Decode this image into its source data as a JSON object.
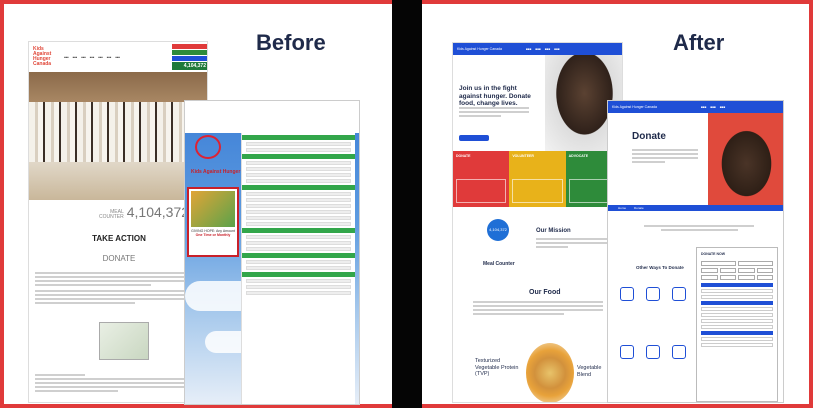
{
  "labels": {
    "before": "Before",
    "after": "After"
  },
  "before_site": {
    "logo": "Kids Against Hunger Canada",
    "meals_counter_value": "4,104,372",
    "meal_counter_label_1": "MEAL",
    "meal_counter_label_2": "COUNTER",
    "take_action": "TAKE ACTION",
    "donate": "DONATE",
    "donate_page": {
      "brand": "Kids Against Hunger",
      "give_hope": "GIVING HOPE: Any Amount",
      "one_time": "One Time or Monthly"
    }
  },
  "after_site": {
    "logo": "Kids Against Hunger Canada",
    "hero_title": "Join us in the fight against hunger. Donate food, change lives.",
    "tiles": [
      {
        "label": "DONATE",
        "color": "#e03a3a"
      },
      {
        "label": "VOLUNTEER",
        "color": "#e8b21a"
      },
      {
        "label": "ADVOCATE",
        "color": "#2e8b3a"
      }
    ],
    "mission": "Our Mission",
    "meal_counter": "Meal Counter",
    "meal_circle_value": "4,104,372",
    "our_food": "Our Food",
    "tvp": "Texturized Vegetable Protein (TVP)",
    "veg": "Vegetable Blend",
    "donate_page": {
      "title": "Donate",
      "tab_home": "Home",
      "tab_donate": "Donate",
      "other_ways": "Other Ways To Donate",
      "form_title": "DONATE NOW"
    }
  },
  "colors": {
    "frame": "#e03a3a",
    "brand_blue": "#1f4fd6",
    "navy": "#1f2a4a"
  }
}
